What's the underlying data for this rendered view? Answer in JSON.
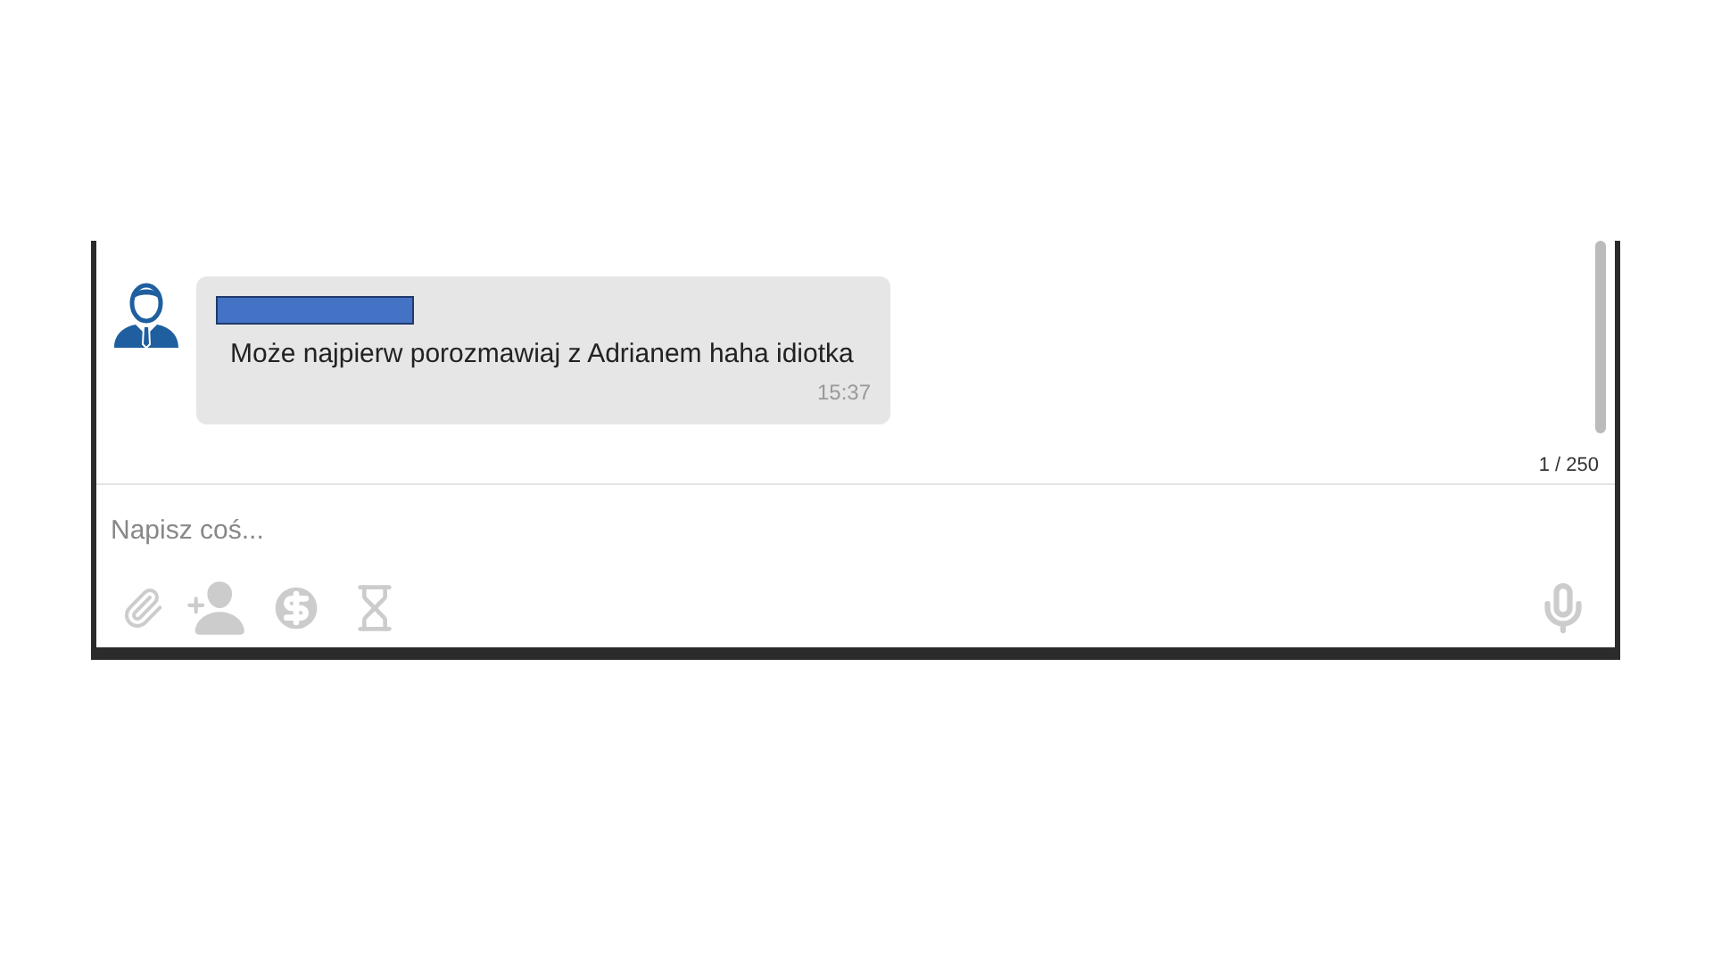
{
  "messages": [
    {
      "text": "Może najpierw porozmawiaj z Adrianem haha idiotka",
      "time": "15:37"
    }
  ],
  "counter": "1 / 250",
  "composer": {
    "placeholder": "Napisz coś..."
  }
}
